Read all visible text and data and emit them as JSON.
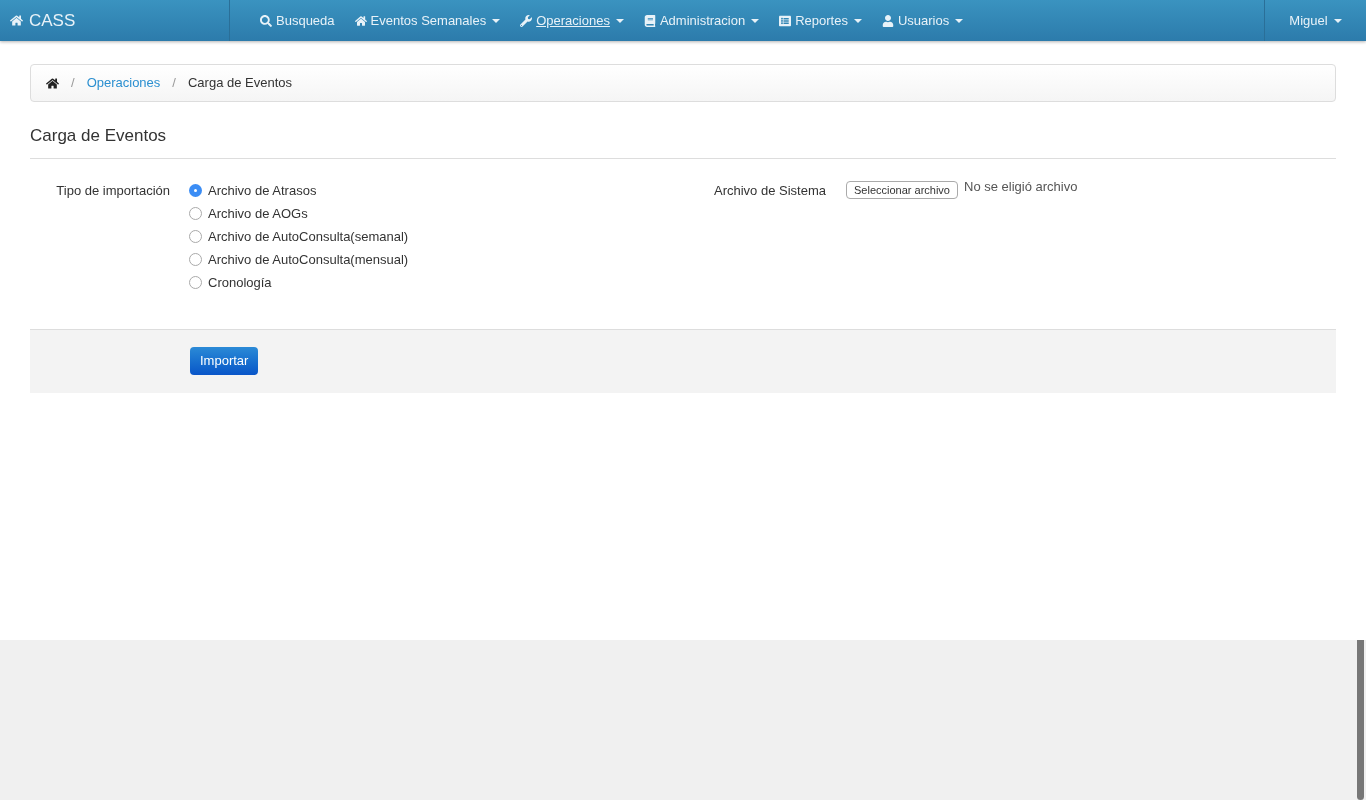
{
  "brand": {
    "title": "CASS"
  },
  "nav": [
    {
      "label": "Busqueda",
      "dropdown": false,
      "selected": false
    },
    {
      "label": "Eventos Semanales",
      "dropdown": true,
      "selected": false
    },
    {
      "label": "Operaciones",
      "dropdown": true,
      "selected": true
    },
    {
      "label": "Administracion",
      "dropdown": true,
      "selected": false
    },
    {
      "label": "Reportes",
      "dropdown": true,
      "selected": false
    },
    {
      "label": "Usuarios",
      "dropdown": true,
      "selected": false
    }
  ],
  "user_menu": {
    "label": "Miguel"
  },
  "breadcrumb": [
    {
      "separator": "/",
      "label": "Operaciones",
      "kind": "link"
    },
    {
      "separator": "/",
      "label": "Carga de Eventos",
      "kind": "current"
    }
  ],
  "page_title": "Carga de Eventos",
  "import_type": {
    "label": "Tipo de importación",
    "options": [
      {
        "label": "Archivo de Atrasos",
        "selected": true
      },
      {
        "label": "Archivo de AOGs",
        "selected": false
      },
      {
        "label": "Archivo de AutoConsulta(semanal)",
        "selected": false
      },
      {
        "label": "Archivo de AutoConsulta(mensual)",
        "selected": false
      },
      {
        "label": "Cronología",
        "selected": false
      }
    ]
  },
  "system_file": {
    "label": "Archivo de Sistema",
    "button": "Seleccionar archivo",
    "status": "No se eligió archivo"
  },
  "submit": "Importar"
}
